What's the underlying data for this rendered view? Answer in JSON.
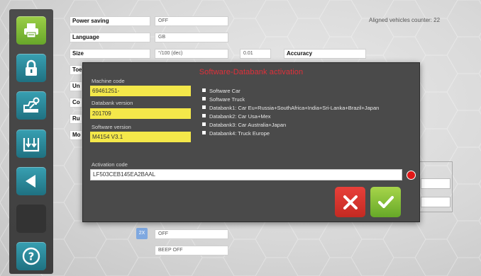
{
  "sidebar": {
    "buttons": [
      {
        "name": "print-button",
        "icon": "printer-icon"
      },
      {
        "name": "lock-button",
        "icon": "lock-icon"
      },
      {
        "name": "car-lift-button",
        "icon": "car-lift-icon"
      },
      {
        "name": "download-button",
        "icon": "download-icon"
      },
      {
        "name": "back-button",
        "icon": "back-arrow-icon"
      },
      {
        "name": "empty-button",
        "icon": ""
      },
      {
        "name": "help-button",
        "icon": "help-icon"
      }
    ]
  },
  "settings": {
    "counter": "Aligned vehicles counter: 22",
    "rows": {
      "power_saving": {
        "label": "Power saving",
        "value": "OFF"
      },
      "language": {
        "label": "Language",
        "value": "GB"
      },
      "size": {
        "label": "Size",
        "value": "°/100 (dec)",
        "step": "0.01",
        "accuracy_label": "Accuracy"
      },
      "toe": {
        "label": "Toe"
      },
      "un": {
        "label": "Un"
      },
      "co": {
        "label": "Co"
      },
      "ru": {
        "label": "Ru"
      },
      "mo": {
        "label": "Mo"
      }
    },
    "twox_badge": "2X",
    "bottom_value_1": "OFF",
    "bottom_value_2": "BEEP OFF"
  },
  "modal": {
    "title": "Software-Databank activation",
    "machine_code_label": "Machine code",
    "machine_code": "69461251-",
    "databank_version_label": "Databank version",
    "databank_version": "201709",
    "software_version_label": "Software version",
    "software_version": "M4154 V3.1",
    "options": [
      "Software Car",
      "Software Truck",
      "Databank1: Car Eu+Russia+SouthAfrica+India+Sri-Lanka+Brazil+Japan",
      "Databank2: Car Usa+Mex",
      "Databank3: Car Australia+Japan",
      "Databank4: Truck Europe"
    ],
    "activation_label": "Activation code",
    "activation_code": "LF503CEB145EA2BAAL",
    "status_color": "#e01818"
  },
  "colors": {
    "accent_green": "#7ab830",
    "accent_teal": "#2b8a9c",
    "title_red": "#e0303a",
    "field_yellow": "#f4e84a"
  }
}
